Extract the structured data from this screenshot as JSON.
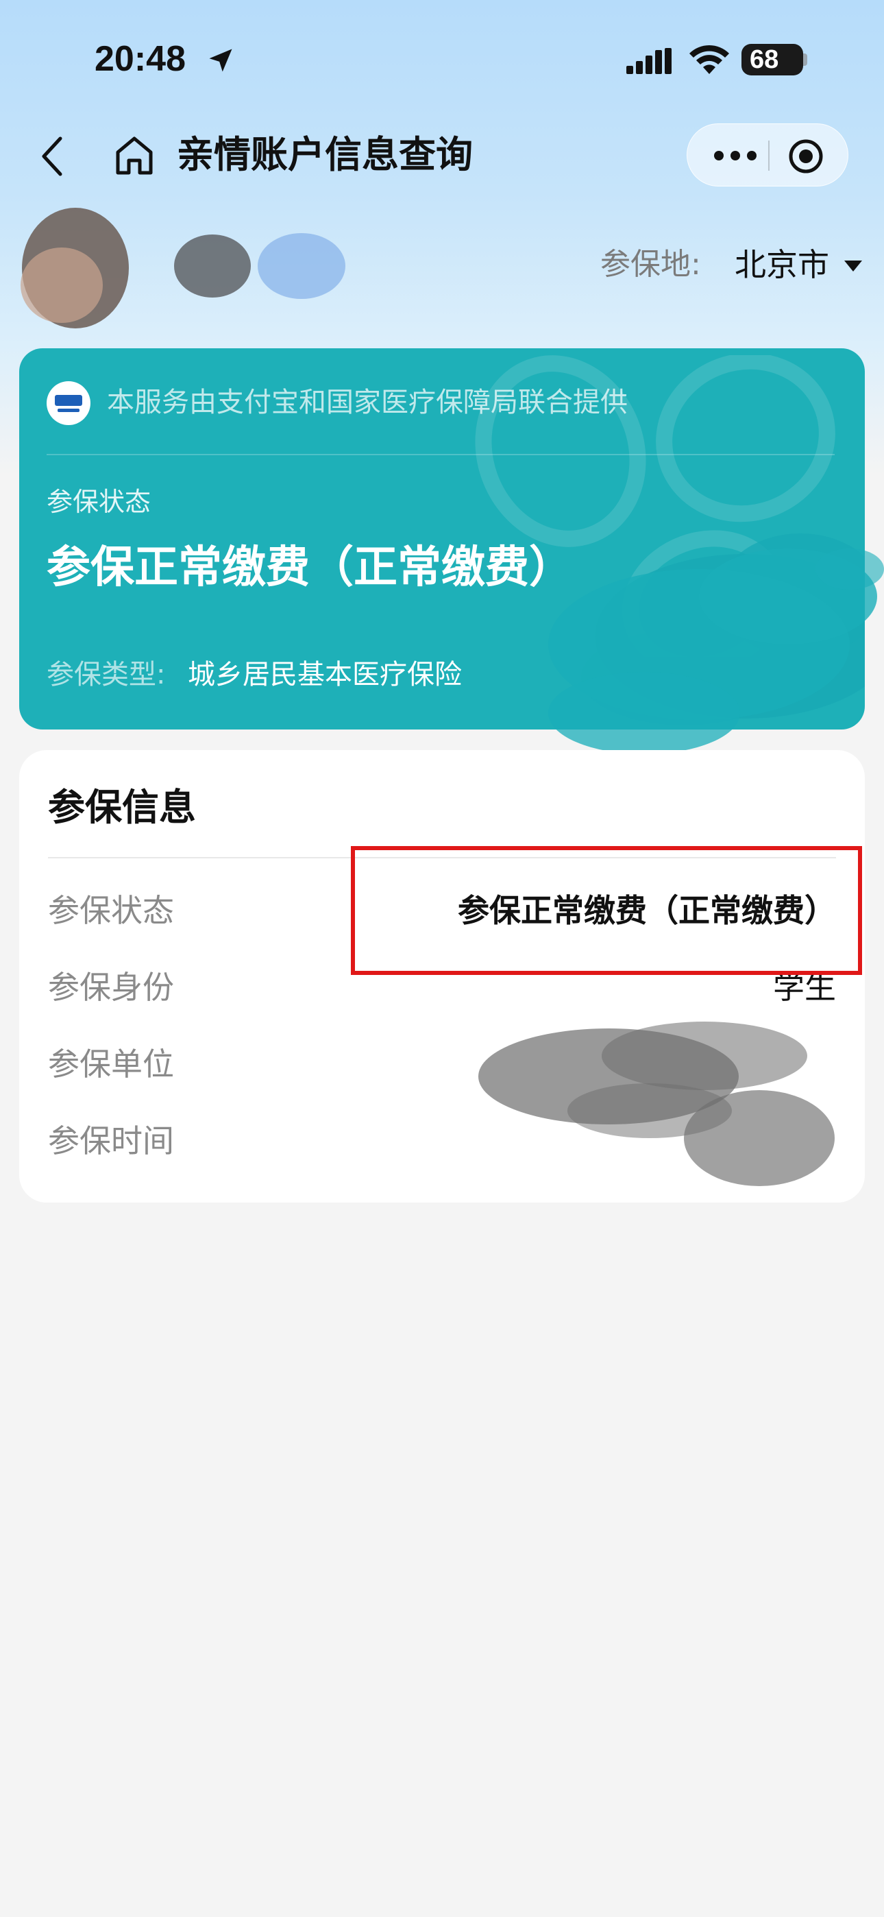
{
  "status_bar": {
    "time": "20:48",
    "battery": "68",
    "location_icon": "location-arrow-icon",
    "signal_icon": "cellular-signal-icon",
    "wifi_icon": "wifi-icon"
  },
  "nav": {
    "title": "亲情账户信息查询",
    "back_icon": "chevron-left-icon",
    "home_icon": "home-icon",
    "more_icon": "more-dots-icon",
    "close_icon": "target-circle-icon"
  },
  "region": {
    "label": "参保地:",
    "value": "北京市",
    "caret_icon": "caret-down-icon"
  },
  "status_card": {
    "provider_text": "本服务由支付宝和国家医疗保障局联合提供",
    "status_label": "参保状态",
    "status_value": "参保正常缴费（正常缴费）",
    "type_label": "参保类型:",
    "type_value": "城乡居民基本医疗保险",
    "background_color": "#1eb0b8"
  },
  "info_card": {
    "title": "参保信息",
    "rows": [
      {
        "label": "参保状态",
        "value": "参保正常缴费（正常缴费）"
      },
      {
        "label": "参保身份",
        "value": "学生"
      },
      {
        "label": "参保单位",
        "value": ""
      },
      {
        "label": "参保时间",
        "value": ""
      }
    ]
  },
  "colors": {
    "accent_teal": "#1eb0b8",
    "highlight_red": "#e01818",
    "page_background": "#f4f4f4"
  }
}
